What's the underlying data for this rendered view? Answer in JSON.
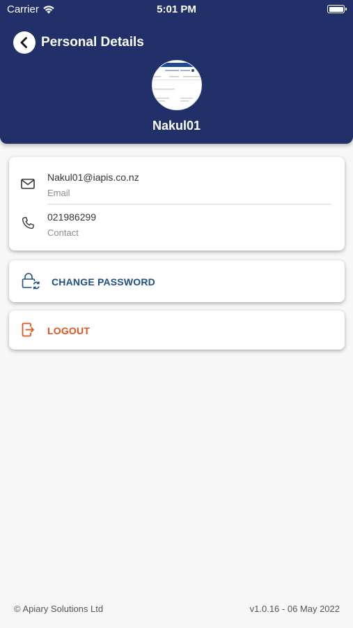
{
  "status_bar": {
    "carrier": "Carrier",
    "time": "5:01 PM"
  },
  "header": {
    "title": "Personal Details",
    "user_name": "Nakul01",
    "background_color": "#22306a"
  },
  "details": {
    "email_value": "Nakul01@iapis.co.nz",
    "email_caption": "Email",
    "contact_value": "021986299",
    "contact_caption": "Contact"
  },
  "actions": {
    "change_password_label": "CHANGE PASSWORD",
    "change_password_color": "#1c4f8a",
    "logout_label": "LOGOUT",
    "logout_color": "#e2531e"
  },
  "icons": {
    "back": "chevron-left-icon",
    "email": "envelope-icon",
    "phone": "phone-icon",
    "change_password": "lock-refresh-icon",
    "logout": "logout-icon",
    "wifi": "wifi-icon",
    "battery": "battery-icon"
  },
  "footer": {
    "copyright": "© Apiary Solutions Ltd",
    "version": "v1.0.16 - 06 May 2022"
  }
}
